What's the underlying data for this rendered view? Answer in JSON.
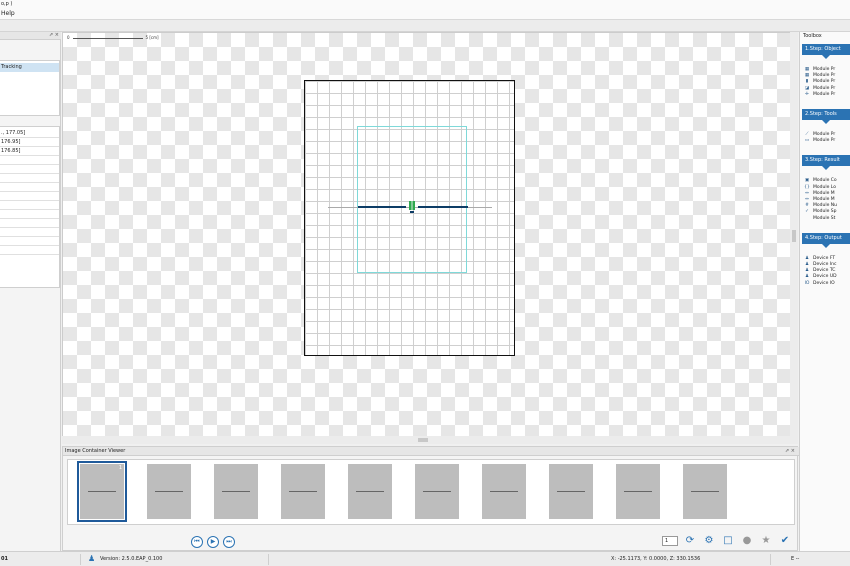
{
  "window": {
    "title_fragment": "o,p )",
    "menu_help": "Help"
  },
  "left_panel": {
    "float_close": "⇗ ×",
    "list_selected": "Tracking",
    "rows": [
      "., 177.05]",
      "176.95]",
      "176.85]",
      "",
      "",
      "",
      "",
      "",
      "",
      "",
      "",
      "",
      "",
      ""
    ],
    "row_icon": "gear-icon"
  },
  "canvas": {
    "scale_start": "0",
    "scale_end": "5 [cm]"
  },
  "toolbox": {
    "title": "Toolbox",
    "steps": [
      {
        "label": "1.Step: Object",
        "items": [
          {
            "icon": "grid-icon",
            "label": "Module Pr"
          },
          {
            "icon": "grid-icon",
            "label": "Module Pr"
          },
          {
            "icon": "bar-icon",
            "label": "Module Pr"
          },
          {
            "icon": "shape-icon",
            "label": "Module Pr"
          },
          {
            "icon": "cross-icon",
            "label": "Module Pr"
          }
        ]
      },
      {
        "label": "2.Step: Tools",
        "items": [
          {
            "icon": "line-icon",
            "label": "Module Pr"
          },
          {
            "icon": "ruler-icon",
            "label": "Module Pr"
          }
        ]
      },
      {
        "label": "3.Step: Result",
        "items": [
          {
            "icon": "box-icon",
            "label": "Module Co"
          },
          {
            "icon": "brace-icon",
            "label": "Module Lo"
          },
          {
            "icon": "arrows-icon",
            "label": "Module M"
          },
          {
            "icon": "arrows-icon",
            "label": "Module M"
          },
          {
            "icon": "number-icon",
            "label": "Module Nu"
          },
          {
            "icon": "check-icon",
            "label": "Module Sp"
          },
          {
            "icon": "none",
            "label": "Module St"
          }
        ]
      },
      {
        "label": "4.Step: Output",
        "items": [
          {
            "icon": "device-icon",
            "label": "Device FT"
          },
          {
            "icon": "device-icon",
            "label": "Device Inc"
          },
          {
            "icon": "device-icon",
            "label": "Device TC"
          },
          {
            "icon": "device-icon",
            "label": "Device UD"
          },
          {
            "icon": "io-icon",
            "label": "Device IO"
          }
        ]
      }
    ]
  },
  "image_viewer": {
    "title": "Image Container Viewer",
    "float_close": "⇗ ×",
    "thumbnail_count": 10,
    "selected_index": 0,
    "selected_badge": "1",
    "nav_prev": "⏮",
    "nav_play": "▶",
    "nav_next": "⏭",
    "spin_value": "1",
    "controls": [
      "⟳",
      "⚙",
      "□",
      "●",
      "★",
      "✔"
    ]
  },
  "status": {
    "left": "01",
    "version": "Version: 2.5.0.EAP_0.100",
    "coordinates": "X: -25.1173, Y: 0.0000, Z: 330.1536",
    "right": "E --"
  },
  "colors": {
    "accent": "#2b73b3",
    "selection": "#cfe3f3",
    "roi": "#7fd9d9",
    "line": "#0d3d66"
  }
}
